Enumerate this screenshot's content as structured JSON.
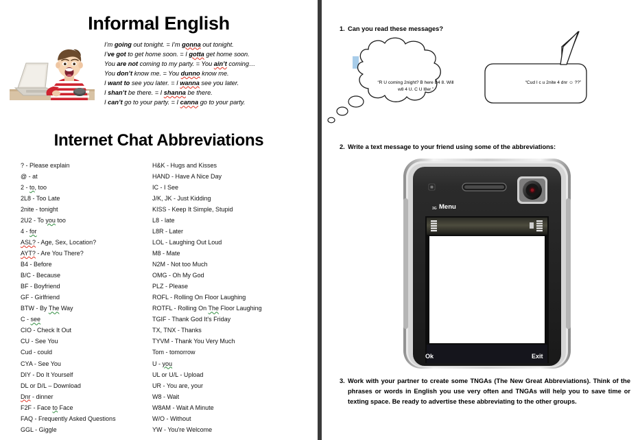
{
  "worksheet": {
    "left": {
      "title": "Informal English",
      "subtitle": "Internet Chat Abbreviations",
      "photo_alt": "boy-at-laptop-photo",
      "sentences": [
        {
          "plain1": "I’m ",
          "bold1": "going",
          "plain2": " out tonight. = I’m ",
          "bold2": "gonna",
          "plain3": " out tonight."
        },
        {
          "plain1": "I’",
          "bold1": "ve got",
          "plain2": " to get home soon. = I ",
          "bold2": "gotta",
          "plain3": " get home soon."
        },
        {
          "plain1": "You ",
          "bold1": "are not",
          "plain2": " coming to my party. = You ",
          "bold2": "ain’t",
          "plain3": " coming…"
        },
        {
          "plain1": "You ",
          "bold1": "don’t",
          "plain2": " know me. = You ",
          "bold2": "dunno",
          "plain3": " know me."
        },
        {
          "plain1": "I ",
          "bold1": "want to",
          "plain2": " see you later. = I ",
          "bold2": "wanna",
          "plain3": " see you later."
        },
        {
          "plain1": "I ",
          "bold1": "shan’t",
          "plain2": " be there. = I ",
          "bold2": "shanna",
          "plain3": " be there."
        },
        {
          "plain1": "I ",
          "bold1": "can’t",
          "plain2": " go to your party. = I ",
          "bold2": "canna",
          "plain3": " go to your party."
        }
      ],
      "abbreviations_col1": [
        "? - Please explain",
        "@ - at",
        "2 - to, too",
        "2L8 - Too Late",
        "2nite - tonight",
        "2U2 - To you too",
        "4 - for",
        "ASL? - Age, Sex, Location?",
        "AYT? - Are You There?",
        "B4 - Before",
        "B/C - Because",
        "BF - Boyfriend",
        "GF - Girlfriend",
        "BTW - By The Way",
        "C - see",
        "CIO - Check It Out",
        "CU - See You",
        "Cud - could",
        "CYA - See You",
        "DIY - Do It Yourself",
        "DL or D/L – Download",
        "Dnr - dinner",
        "F2F - Face to Face",
        "FAQ - Frequently Asked Questions",
        "GGL - Giggle"
      ],
      "abbreviations_col2": [
        "H&K - Hugs and Kisses",
        "HAND - Have A Nice Day",
        "IC - I See",
        "J/K, JK - Just Kidding",
        "KISS - Keep It Simple, Stupid",
        "L8 - late",
        "L8R - Later",
        "LOL - Laughing Out Loud",
        "M8 - Mate",
        "N2M - Not too Much",
        "OMG - Oh My God",
        "PLZ - Please",
        "ROFL - Rolling On Floor Laughing",
        "ROTFL - Rolling On The Floor Laughing",
        "TGIF - Thank God It's Friday",
        "TX, TNX - Thanks",
        "TYVM - Thank You Very Much",
        "Tom - tomorrow",
        "U - you",
        "UL or U/L - Upload",
        "UR - You are, your",
        "W8 - Wait",
        "W8AM - Wait A Minute",
        "W/O - Without",
        "YW - You're Welcome"
      ]
    },
    "right": {
      "exercises": [
        {
          "number": "1.",
          "text": "Can you read these messages?"
        },
        {
          "number": "2.",
          "text": "Write a text message to your friend using some of the abbreviations:"
        },
        {
          "number": "3.",
          "text": "Work with your partner to create some TNGAs (The New Great Abbreviations). Think of the phrases or words in English you use very often and TNGAs will help you to save time or texting space. Be ready to advertise these abbreviating to the other groups."
        }
      ],
      "thought_bubble": "“R U coming 2night? B here B4 8. Will w8 4 U. C U l8er.”",
      "speech_bubble": "“Cud I c u 2nite 4 dnr ☺ ??”",
      "phone": {
        "status_label": "Menu",
        "network": "3G",
        "softkey_left": "Ok",
        "softkey_right": "Exit"
      }
    }
  },
  "colors": {
    "divider": "#3b3b3b",
    "marker_blue": "#a8cdea",
    "spellcheck_red": "#e03020",
    "spellcheck_green": "#2e8b3d",
    "phone_screen_bar": "#1a1a22"
  }
}
